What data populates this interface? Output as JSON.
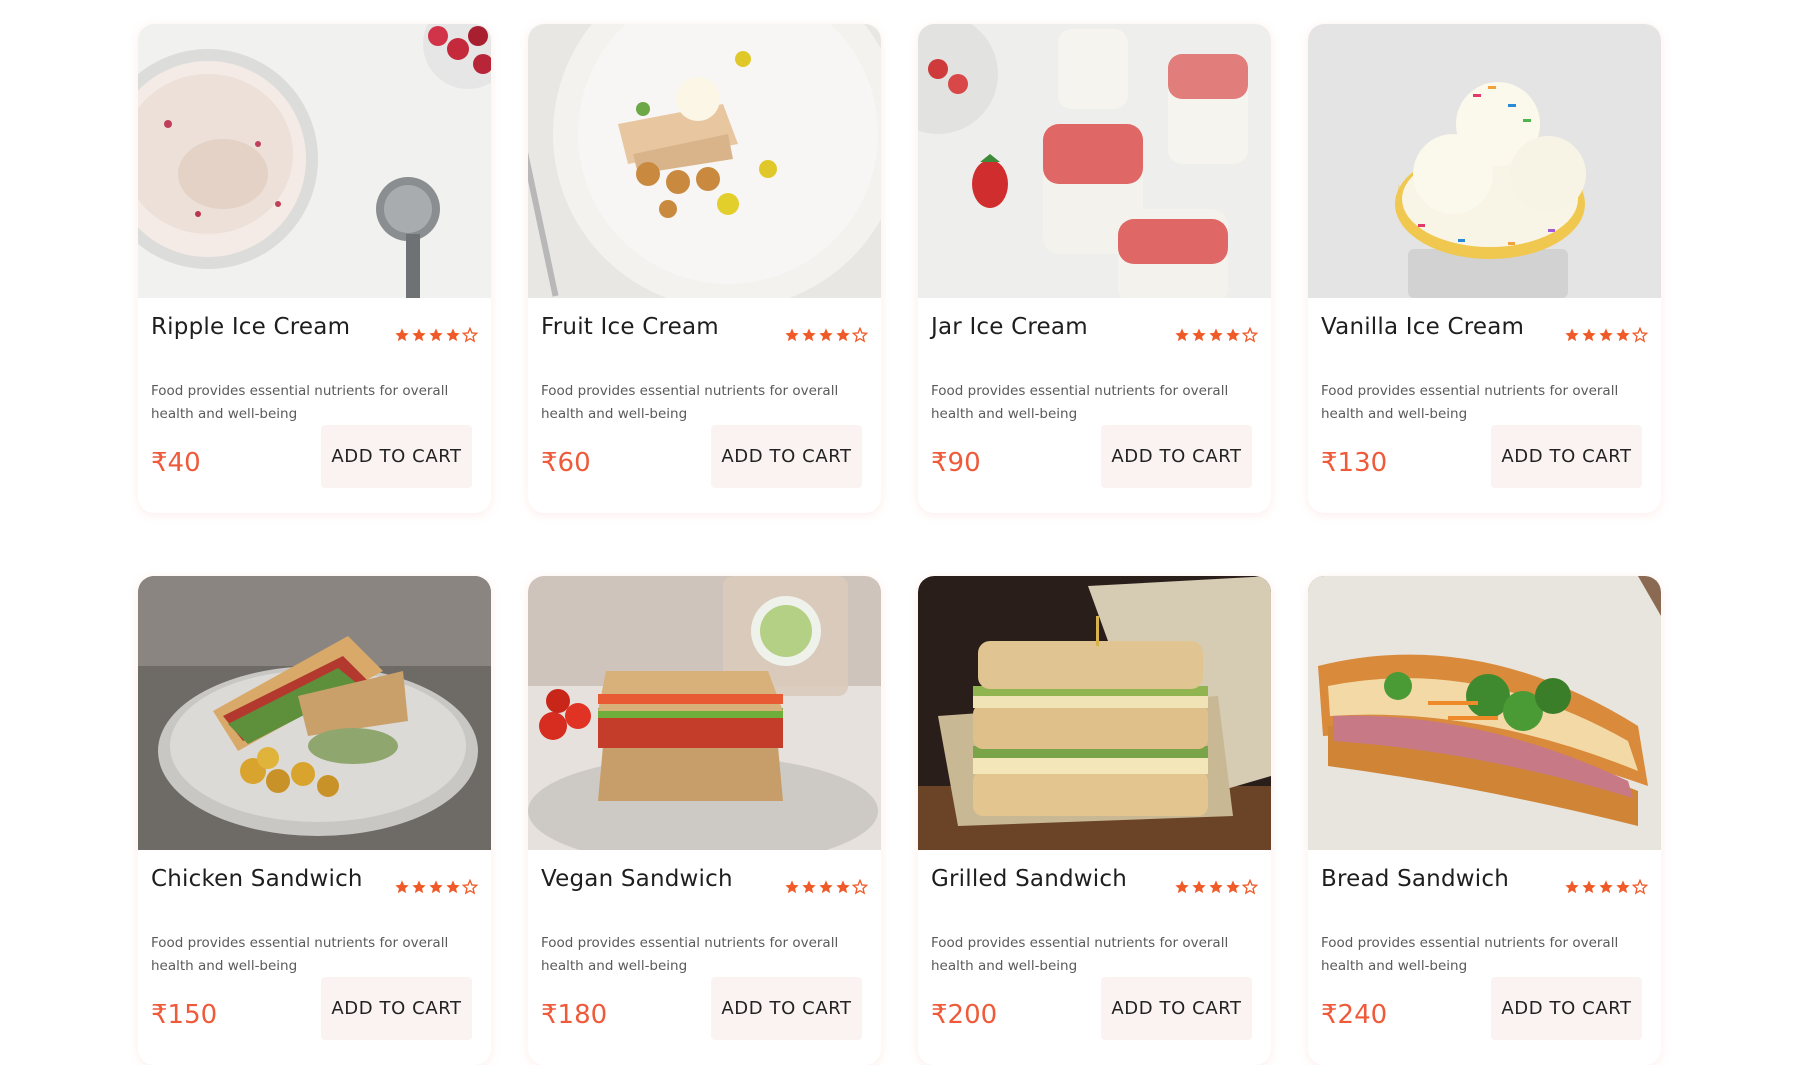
{
  "products": [
    {
      "title": "Ripple Ice Cream",
      "desc": "Food provides essential nutrients for overall health and well-being",
      "price": "₹40",
      "rating": 4,
      "button": "ADD TO CART"
    },
    {
      "title": "Fruit Ice Cream",
      "desc": "Food provides essential nutrients for overall health and well-being",
      "price": "₹60",
      "rating": 4,
      "button": "ADD TO CART"
    },
    {
      "title": "Jar Ice Cream",
      "desc": "Food provides essential nutrients for overall health and well-being",
      "price": "₹90",
      "rating": 4,
      "button": "ADD TO CART"
    },
    {
      "title": "Vanilla Ice Cream",
      "desc": "Food provides essential nutrients for overall health and well-being",
      "price": "₹130",
      "rating": 4,
      "button": "ADD TO CART"
    },
    {
      "title": "Chicken Sandwich",
      "desc": "Food provides essential nutrients for overall health and well-being",
      "price": "₹150",
      "rating": 4,
      "button": "ADD TO CART"
    },
    {
      "title": "Vegan Sandwich",
      "desc": "Food provides essential nutrients for overall health and well-being",
      "price": "₹180",
      "rating": 4,
      "button": "ADD TO CART"
    },
    {
      "title": "Grilled Sandwich",
      "desc": "Food provides essential nutrients for overall health and well-being",
      "price": "₹200",
      "rating": 4,
      "button": "ADD TO CART"
    },
    {
      "title": "Bread Sandwich",
      "desc": "Food provides essential nutrients for overall health and well-being",
      "price": "₹240",
      "rating": 4,
      "button": "ADD TO CART"
    }
  ],
  "rating_max": 5,
  "colors": {
    "accent": "#ee5a3a",
    "star": "#f05a28",
    "button_bg": "#faf3f2"
  }
}
